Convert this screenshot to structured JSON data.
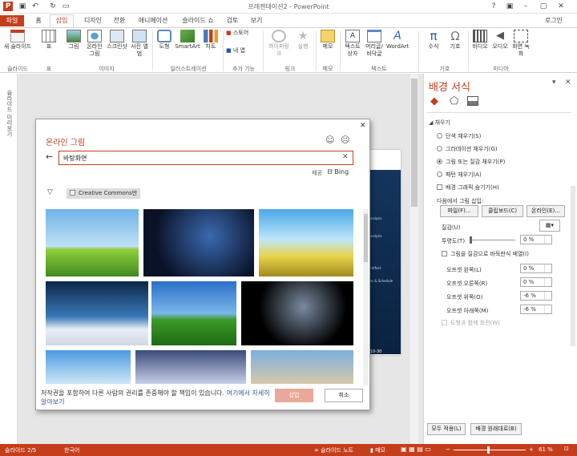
{
  "window": {
    "title": "프레젠테이션2 - PowerPoint",
    "user": "로그인"
  },
  "tabs": [
    "파일",
    "홈",
    "삽입",
    "디자인",
    "전환",
    "애니메이션",
    "슬라이드 쇼",
    "검토",
    "보기"
  ],
  "ribbon": {
    "buttons": [
      "새 슬라이드",
      "표",
      "그림",
      "온라인 그림",
      "스크린샷",
      "사진 앨범",
      "도형",
      "SmartArt",
      "차트",
      "스토어",
      "내 앱",
      "하이퍼링크",
      "실행",
      "메모",
      "텍스트 상자",
      "머리글/바닥글",
      "WordArt",
      "수식",
      "기호",
      "비디오",
      "오디오",
      "화면 녹화"
    ],
    "groups": [
      "슬라이드",
      "표",
      "이미지",
      "일러스트레이션",
      "추가 기능",
      "링크",
      "메모",
      "텍스트",
      "기호",
      "미디어"
    ]
  },
  "left_pane_label": "슬라이드 미리보기",
  "slide": {
    "lines": [
      "Analysis",
      "Analysis",
      "d effect",
      "ion & Schedule",
      "-10-30"
    ]
  },
  "dialog": {
    "title": "온라인 그림",
    "search_value": "바탕화면",
    "provider_label": "제공",
    "provider_name": "Bing",
    "filter_label": "Creative Commons만",
    "footer_text": "저작권을 포함하여 다른 사람의 권리를 존중해야 할 책임이 있습니다.",
    "footer_link": "여기에서 자세히 알아보기",
    "insert_label": "삽입",
    "cancel_label": "취소"
  },
  "format_pane": {
    "title": "배경 서식",
    "section": "채우기",
    "fill_options": [
      "단색 채우기(S)",
      "그라데이션 채우기(G)",
      "그림 또는 질감 채우기(P)",
      "패턴 채우기(A)"
    ],
    "selected_fill": 2,
    "hide_bg": "배경 그래픽 숨기기(H)",
    "insert_from": "다음에서 그림 삽입:",
    "file_btn": "파일(F)...",
    "clipboard_btn": "클립보드(C)",
    "online_btn": "온라인(E)...",
    "texture_label": "질감(U)",
    "transparency_label": "투명도(T)",
    "transparency_value": "0 %",
    "tile_label": "그림을 질감으로 바둑판식 배열(I)",
    "offsets": [
      {
        "label": "오프셋 왼쪽(L)",
        "value": "0 %"
      },
      {
        "label": "오프셋 오른쪽(R)",
        "value": "0 %"
      },
      {
        "label": "오프셋 위쪽(O)",
        "value": "-6 %"
      },
      {
        "label": "오프셋 아래쪽(M)",
        "value": "-6 %"
      }
    ],
    "rotate_label": "도형과 함께 회전(W)",
    "apply_all": "모두 적용(L)",
    "reset_bg": "배경 원래대로(B)"
  },
  "status": {
    "slide": "슬라이드 2/5",
    "lang": "한국어",
    "notes": "슬라이드 노트",
    "memo": "메모",
    "zoom": "61 %"
  },
  "colors": {
    "accent": "#c43e1c",
    "link": "#2b579a"
  }
}
